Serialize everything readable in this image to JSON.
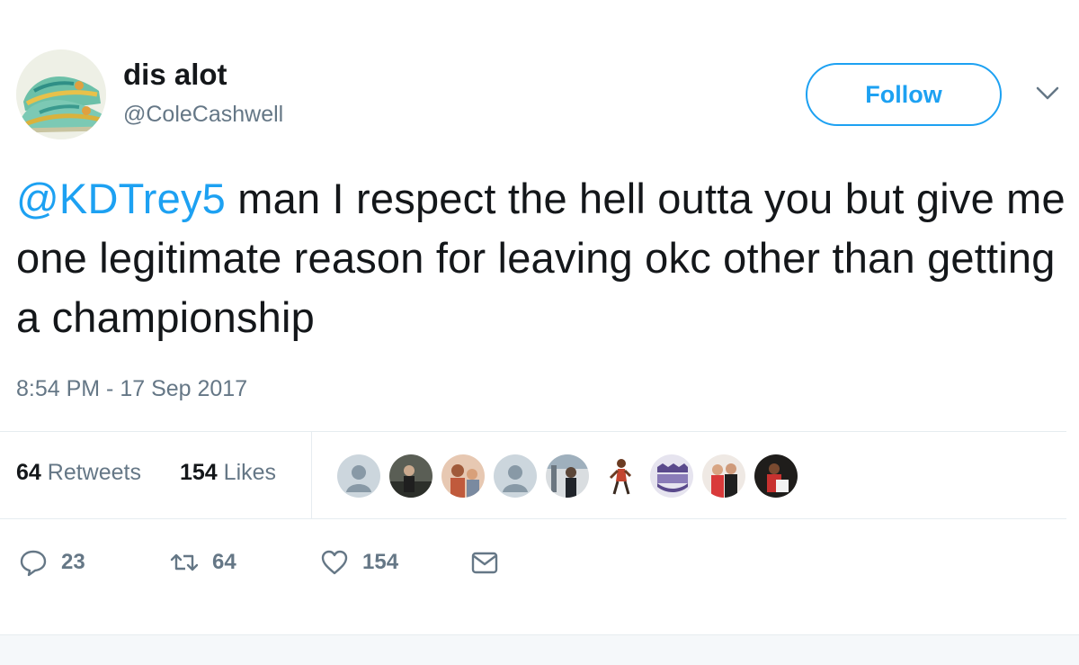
{
  "user": {
    "display_name": "dis alot",
    "handle": "@ColeCashwell",
    "avatar_icon": "sneaker-avatar"
  },
  "follow": {
    "label": "Follow"
  },
  "menu": {
    "icon": "chevron-down-icon"
  },
  "tweet": {
    "mention": "@KDTrey5",
    "text": " man I respect the hell outta you but give me one legitimate reason for leaving okc other than getting a championship",
    "timestamp": "8:54 PM - 17 Sep 2017"
  },
  "stats": {
    "retweets_count": "64",
    "retweets_label": " Retweets",
    "likes_count": "154",
    "likes_label": " Likes"
  },
  "likers": [
    {
      "kind": "default-avatar"
    },
    {
      "kind": "photo-avatar"
    },
    {
      "kind": "photo-avatar"
    },
    {
      "kind": "default-avatar"
    },
    {
      "kind": "photo-avatar"
    },
    {
      "kind": "photo-avatar"
    },
    {
      "kind": "logo-avatar"
    },
    {
      "kind": "photo-avatar"
    },
    {
      "kind": "photo-avatar"
    }
  ],
  "actions": {
    "reply_count": "23",
    "retweet_count": "64",
    "like_count": "154"
  },
  "colors": {
    "accent": "#1da1f2",
    "text": "#14171a",
    "muted": "#657786",
    "divider": "#e6ecf0"
  }
}
